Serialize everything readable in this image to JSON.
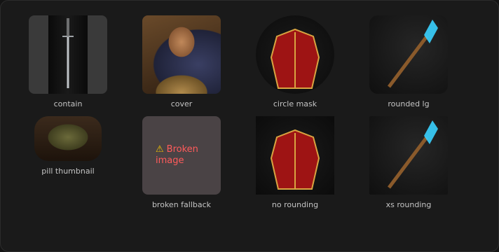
{
  "captions": {
    "contain": "contain",
    "cover": "cover",
    "circle_mask": "circle mask",
    "rounded_lg": "rounded lg",
    "pill_thumbnail": "pill thumbnail",
    "broken_fallback": "broken fallback",
    "no_rounding": "no rounding",
    "xs_rounding": "xs rounding"
  },
  "broken_image": {
    "icon": "warning-icon",
    "text": "Broken image"
  },
  "colors": {
    "panel_bg": "#1a1a1a",
    "caption": "#c4c4c4",
    "broken_bg": "#4a4345",
    "broken_text": "#ff5b5b"
  }
}
